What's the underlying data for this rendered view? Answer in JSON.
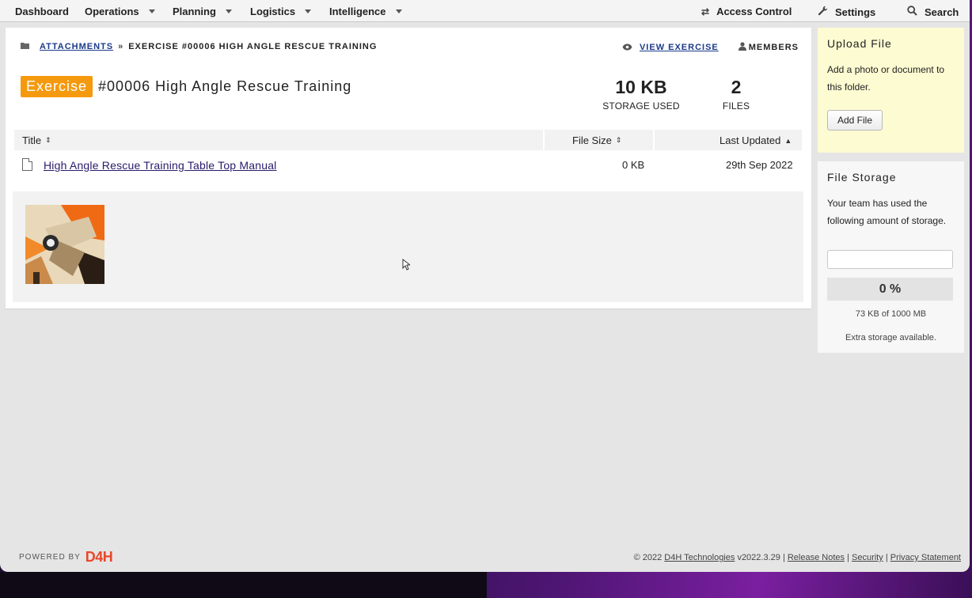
{
  "nav": {
    "items": [
      {
        "label": "Dashboard"
      },
      {
        "label": "Operations"
      },
      {
        "label": "Planning"
      },
      {
        "label": "Logistics"
      },
      {
        "label": "Intelligence"
      }
    ],
    "access_control": "Access Control",
    "settings": "Settings",
    "search": "Search"
  },
  "breadcrumb": {
    "link": "ATTACHMENTS",
    "separator": "»",
    "current": "EXERCISE #00006 HIGH ANGLE RESCUE TRAINING"
  },
  "actions": {
    "view": "VIEW EXERCISE",
    "members": "MEMBERS"
  },
  "header": {
    "badge": "Exercise",
    "title": "#00006 High Angle Rescue Training"
  },
  "stats": {
    "storage_value": "10 KB",
    "storage_label": "STORAGE USED",
    "files_value": "2",
    "files_label": "FILES"
  },
  "table": {
    "columns": {
      "title": "Title",
      "size": "File Size",
      "updated": "Last Updated"
    },
    "rows": [
      {
        "title": "High Angle Rescue Training Table Top Manual",
        "size": "0 KB",
        "updated": "29th Sep 2022"
      }
    ]
  },
  "upload": {
    "heading": "Upload File",
    "text": "Add a photo or document to this folder.",
    "button": "Add File"
  },
  "storage": {
    "heading": "File Storage",
    "text": "Your team has used the following amount of storage.",
    "percent_value": 0,
    "percent_label": "0 %",
    "used": "73 KB of 1000 MB",
    "extra": "Extra storage available."
  },
  "footer": {
    "powered_by": "POWERED BY",
    "logo": "D4H",
    "copyright": "© 2022",
    "company": "D4H Technologies",
    "version": "v2022.3.29",
    "sep": "|",
    "release_notes": "Release Notes",
    "security": "Security",
    "privacy": "Privacy Statement"
  },
  "colors": {
    "accent": "#f59a0e",
    "link": "#1a3a8a",
    "logo": "#e8482a",
    "upload_bg": "#fdfbd2"
  }
}
